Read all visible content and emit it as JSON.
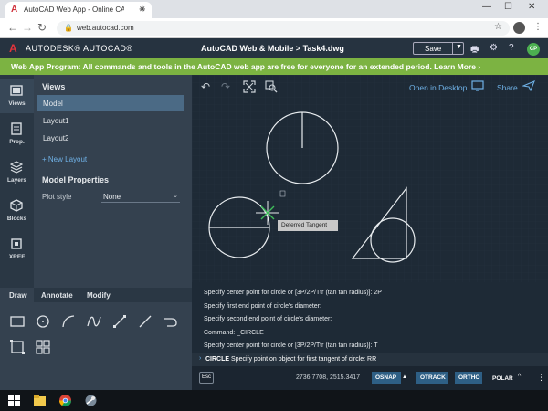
{
  "browser": {
    "tab_title": "AutoCAD Web App - Online CAD",
    "url": "web.autocad.com",
    "controls": {
      "minimize": "—",
      "maximize": "☐",
      "close": "✕"
    }
  },
  "app": {
    "brand": "AUTODESK® AUTOCAD®",
    "doc_title": "AutoCAD Web & Mobile > Task4.dwg",
    "save_label": "Save",
    "avatar_initials": "CP"
  },
  "banner": {
    "message": "Web App Program: All commands and tools in the AutoCAD web app are free for everyone for an extended period.  Learn More ›",
    "color": "#7cb342"
  },
  "rail": {
    "items": [
      {
        "label": "Views",
        "icon": "views-icon"
      },
      {
        "label": "Prop.",
        "icon": "properties-icon"
      },
      {
        "label": "Layers",
        "icon": "layers-icon"
      },
      {
        "label": "Blocks",
        "icon": "blocks-icon"
      },
      {
        "label": "XREF",
        "icon": "xref-icon"
      }
    ]
  },
  "panel": {
    "views_title": "Views",
    "views": [
      "Model",
      "Layout1",
      "Layout2"
    ],
    "selected_view": "Model",
    "new_layout": "+  New Layout",
    "props_title": "Model Properties",
    "plot_style_label": "Plot style",
    "plot_style_value": "None"
  },
  "draw_palette": {
    "tabs": [
      "Draw",
      "Annotate",
      "Modify"
    ],
    "active_tab": "Draw",
    "tools": [
      "rectangle-tool",
      "circle-tool",
      "arc-tool",
      "spline-tool",
      "move-tool",
      "line-tool",
      "polyline-tool",
      "table-tool",
      "block-tool"
    ]
  },
  "canvas": {
    "open_in_desktop": "Open in Desktop",
    "share": "Share",
    "tooltip": "Deferred Tangent"
  },
  "command": {
    "history": [
      "Specify center point for circle or [3P/2P/Ttr (tan tan radius)]: 2P",
      "Specify first end point of circle's diameter:",
      "Specify second end point of circle's diameter:",
      "Command:  _CIRCLE",
      "Specify center point for circle or [3P/2P/Ttr (tan tan radius)]: T"
    ],
    "current_name": "CIRCLE",
    "current_prompt": "Specify point on object for first tangent of circle: RR"
  },
  "status": {
    "esc": "Esc",
    "coordinates": "2736.7708, 2515.3417",
    "osnap": "OSNAP",
    "otrack": "OTRACK",
    "ortho": "ORTHO",
    "polar": "POLAR",
    "accent": "#2e5f85"
  }
}
